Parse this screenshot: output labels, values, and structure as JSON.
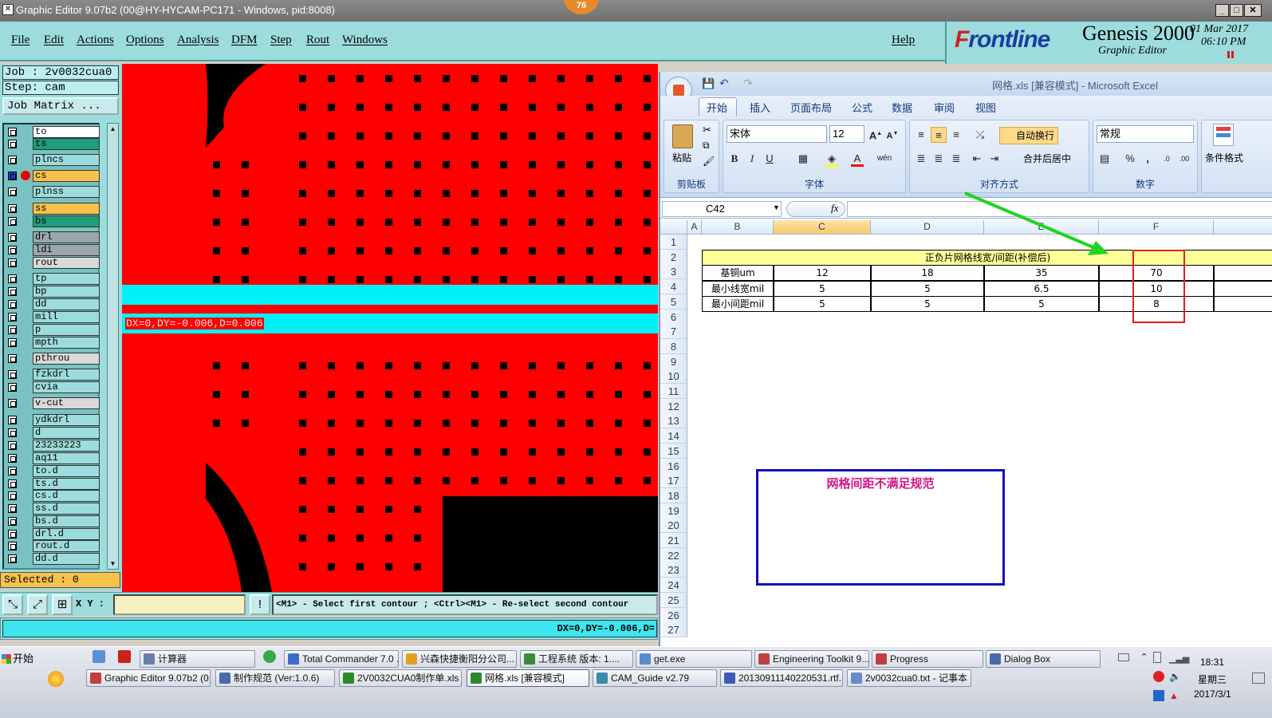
{
  "titlebar": {
    "title": "Graphic Editor 9.07b2 (00@HY-HYCAM-PC171 - Windows, pid:8008)",
    "badge": "76",
    "min": "_",
    "max": "□",
    "close": "✕"
  },
  "menu": {
    "items": [
      "File",
      "Edit",
      "Actions",
      "Options",
      "Analysis",
      "DFM",
      "Step",
      "Rout",
      "Windows"
    ],
    "help": "Help"
  },
  "brand": {
    "logo_f": "F",
    "logo_rest": "rontline",
    "product": "Genesis 2000",
    "subtitle": "Graphic Editor",
    "date": "01 Mar 2017",
    "time": "06:10 PM"
  },
  "job": {
    "job_text": "Job : 2v0032cua0",
    "step_text": "Step: cam",
    "matrix_button": "Job Matrix ..."
  },
  "layers": [
    {
      "name": "to",
      "color": "#ffffff"
    },
    {
      "name": "ts",
      "color": "#1f9c7a"
    },
    {
      "name": "plncs",
      "color": "#9ddcdc"
    },
    {
      "name": "cs",
      "color": "#f7c14a"
    },
    {
      "name": "plnss",
      "color": "#9ddcdc"
    },
    {
      "name": "ss",
      "color": "#f7c14a"
    },
    {
      "name": "bs",
      "color": "#1f9c7a"
    },
    {
      "name": "drl",
      "color": "#9aa7ad"
    },
    {
      "name": "ldi",
      "color": "#9aa7ad"
    },
    {
      "name": "rout",
      "color": "#d9d9d9"
    },
    {
      "name": "tp",
      "color": "#9ddcdc"
    },
    {
      "name": "bp",
      "color": "#9ddcdc"
    },
    {
      "name": "dd",
      "color": "#9ddcdc"
    },
    {
      "name": "mill",
      "color": "#9ddcdc"
    },
    {
      "name": "p",
      "color": "#9ddcdc"
    },
    {
      "name": "mpth",
      "color": "#9ddcdc"
    },
    {
      "name": "pthrou",
      "color": "#d9d9d9"
    },
    {
      "name": "fzkdrl",
      "color": "#9ddcdc"
    },
    {
      "name": "cvia",
      "color": "#9ddcdc"
    },
    {
      "name": "v-cut",
      "color": "#d9d9d9"
    },
    {
      "name": "ydkdrl",
      "color": "#9ddcdc"
    },
    {
      "name": "d",
      "color": "#9ddcdc"
    },
    {
      "name": "23233223",
      "color": "#9ddcdc"
    },
    {
      "name": "aq11",
      "color": "#9ddcdc"
    },
    {
      "name": "to.d",
      "color": "#9ddcdc"
    },
    {
      "name": "ts.d",
      "color": "#9ddcdc"
    },
    {
      "name": "cs.d",
      "color": "#9ddcdc"
    },
    {
      "name": "ss.d",
      "color": "#9ddcdc"
    },
    {
      "name": "bs.d",
      "color": "#9ddcdc"
    },
    {
      "name": "drl.d",
      "color": "#9ddcdc"
    },
    {
      "name": "rout.d",
      "color": "#9ddcdc"
    },
    {
      "name": "dd.d",
      "color": "#9ddcdc"
    }
  ],
  "selected": "Selected : 0",
  "canvas": {
    "measure_text": "DX=0,DY=-0.006,D=0.006"
  },
  "bottom": {
    "xy_label": "X Y :",
    "xy_value": "",
    "prompt": "<M1> - Select first contour ; <Ctrl><M1> - Re-select second contour",
    "coord": "DX=0,DY=-0.006,D="
  },
  "excel": {
    "title": "网格.xls [兼容模式] - Microsoft Excel",
    "tabs": [
      "开始",
      "插入",
      "页面布局",
      "公式",
      "数据",
      "审阅",
      "视图"
    ],
    "groups": {
      "clipboard": "剪贴板",
      "font": "字体",
      "align": "对齐方式",
      "number": "数字",
      "paste": "粘贴",
      "cond": "条件格式",
      "wrap": "自动换行",
      "merge": "合并后居中"
    },
    "font_name": "宋体",
    "font_size": "12",
    "number_format": "常规",
    "name_box": "C42",
    "fx": "fx",
    "columns": [
      "A",
      "B",
      "C",
      "D",
      "E",
      "F"
    ],
    "rows": [
      "1",
      "2",
      "3",
      "4",
      "5",
      "6",
      "7",
      "8",
      "9",
      "10",
      "11",
      "12",
      "13",
      "14",
      "15",
      "16",
      "17",
      "18",
      "19",
      "20",
      "21",
      "22",
      "23",
      "24",
      "25",
      "26",
      "27"
    ],
    "table": {
      "header": "正负片网格线宽/间距(补偿后)",
      "rows": [
        {
          "label": "基铜um",
          "c": "12",
          "d": "18",
          "e": "35",
          "f": "70"
        },
        {
          "label": "最小线宽mil",
          "c": "5",
          "d": "5",
          "e": "6.5",
          "f": "10"
        },
        {
          "label": "最小间距mil",
          "c": "5",
          "d": "5",
          "e": "5",
          "f": "8"
        }
      ]
    },
    "note": "网格间距不满足规范"
  },
  "taskbar": {
    "start": "开始",
    "row1": [
      "计算器",
      "Total Commander 7.0 ...",
      "兴森快捷衡阳分公司...",
      "工程系统  版本: 1....",
      "get.exe",
      "Engineering Toolkit 9....",
      "Progress",
      "Dialog Box"
    ],
    "row2": [
      "Graphic Editor 9.07b2 (0...",
      "制作规范 (Ver:1.0.6)",
      "2V0032CUA0制作单.xls ...",
      "网格.xls [兼容模式]",
      "CAM_Guide v2.79",
      "20130911140220531.rtf...",
      "2v0032cua0.txt - 记事本"
    ],
    "clock": "18:31",
    "weekday": "星期三",
    "date": "2017/3/1"
  },
  "colors": {
    "canvas": "#ff0000",
    "panel": "#9ddcdc",
    "highlight": "#00f0f8",
    "accent_box": "#1010c0",
    "note_text": "#d5168a",
    "arrow": "#1fd51f"
  }
}
